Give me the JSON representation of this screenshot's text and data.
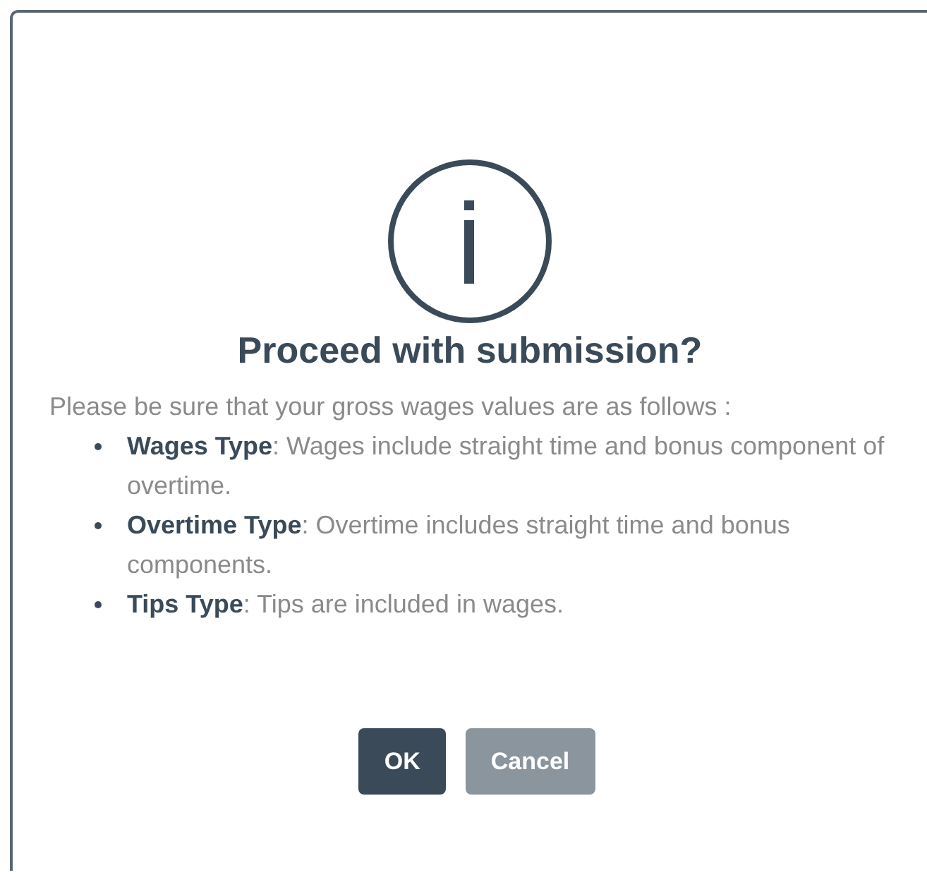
{
  "dialog": {
    "title": "Proceed with submission?",
    "message": "Please be sure that your gross wages values are as follows :",
    "items": [
      {
        "term": "Wages Type",
        "text": ": Wages include straight time and bonus component of overtime."
      },
      {
        "term": "Overtime Type",
        "text": ": Overtime includes straight time and bonus components."
      },
      {
        "term": "Tips Type",
        "text": ": Tips are included in wages."
      }
    ],
    "buttons": [
      {
        "label": "OK",
        "kind": "primary"
      },
      {
        "label": "Cancel",
        "kind": "secondary"
      }
    ]
  }
}
